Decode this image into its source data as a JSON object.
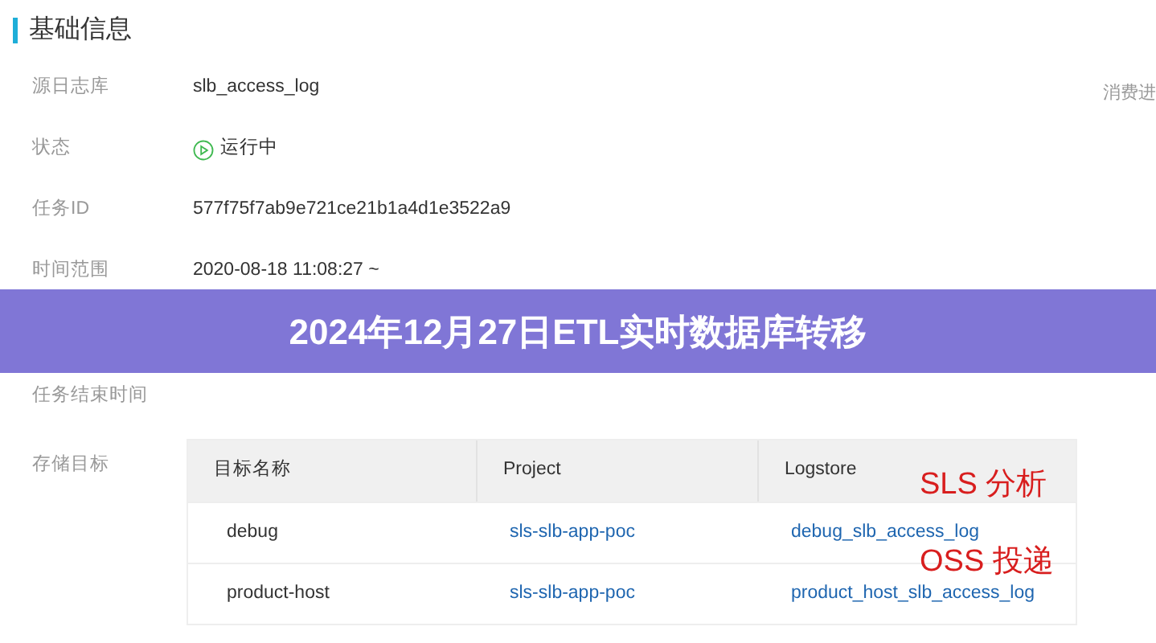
{
  "section_title": "基础信息",
  "side_label": "消费进",
  "fields": [
    {
      "label": "源日志库",
      "kind": "text",
      "value": "slb_access_log"
    },
    {
      "label": "状态",
      "kind": "status",
      "value": "运行中"
    },
    {
      "label": "任务ID",
      "kind": "text",
      "value": "577f75f7ab9e721ce21b1a4d1e3522a9"
    },
    {
      "label": "时间范围",
      "kind": "text",
      "value": "2020-08-18 11:08:27 ~"
    },
    {
      "label": "任务结束时间",
      "kind": "text"
    },
    {
      "label": "存储目标",
      "kind": "table"
    }
  ],
  "table": {
    "columns": [
      "目标名称",
      "Project",
      "Logstore"
    ],
    "rows": [
      [
        "debug",
        "sls-slb-app-poc",
        "debug_slb_access_log"
      ],
      [
        "product-host",
        "sls-slb-app-poc",
        "product_host_slb_access_log"
      ]
    ]
  },
  "annotations": [
    "SLS 分析",
    "OSS 投递"
  ],
  "banner": {
    "title": "2024年12月27日ETL实时数据库转移"
  }
}
